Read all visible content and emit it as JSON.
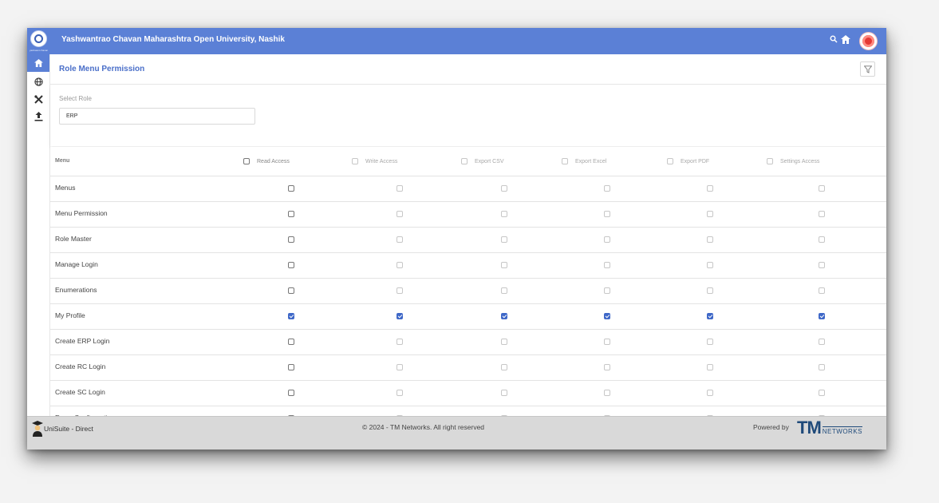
{
  "header": {
    "app_title": "Yashwantrao Chavan Maharashtra Open University, Nashik",
    "logo_caption": "yashwant chavan",
    "icons": [
      "search-icon",
      "home-icon"
    ]
  },
  "sidebar": {
    "items": [
      {
        "name": "home",
        "icon": "home-icon",
        "glyph": "⌂",
        "active": true
      },
      {
        "name": "globe",
        "icon": "globe-icon",
        "glyph": "⊕",
        "active": false
      },
      {
        "name": "tools",
        "icon": "tools-icon",
        "glyph": "✕",
        "active": false
      },
      {
        "name": "upload",
        "icon": "upload-icon",
        "glyph": "⇧",
        "active": false
      }
    ]
  },
  "page": {
    "title": "Role Menu Permission",
    "filter_icon": "filter-icon",
    "role_label": "Select Role",
    "role_value": "ERP"
  },
  "table": {
    "columns": [
      "Menu",
      "Read Access",
      "Write Access",
      "Export CSV",
      "Export Excel",
      "Export PDF",
      "Settings Access"
    ],
    "rows": [
      {
        "name": "Menus",
        "checked": false
      },
      {
        "name": "Menu Permission",
        "checked": false
      },
      {
        "name": "Role Master",
        "checked": false
      },
      {
        "name": "Manage Login",
        "checked": false
      },
      {
        "name": "Enumerations",
        "checked": false
      },
      {
        "name": "My Profile",
        "checked": true
      },
      {
        "name": "Create ERP Login",
        "checked": false
      },
      {
        "name": "Create RC Login",
        "checked": false
      },
      {
        "name": "Create SC Login",
        "checked": false
      },
      {
        "name": "Exam Configurations",
        "checked": false
      }
    ]
  },
  "footer": {
    "brand": "UniSuite - Direct",
    "copyright": "© 2024 - TM Networks. All right reserved",
    "powered_by": "Powered by",
    "logo_big": "TM",
    "logo_small": "NETWORKS"
  },
  "colors": {
    "primary": "#5b80d6",
    "checked": "#3f68c8",
    "footer": "#d9d9d9"
  }
}
